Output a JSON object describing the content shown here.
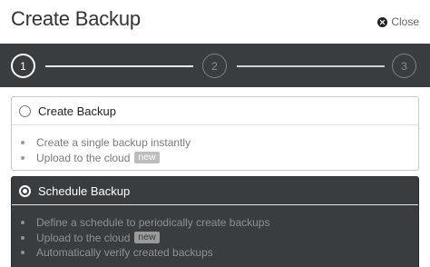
{
  "dialog": {
    "title": "Create Backup",
    "close_label": "Close"
  },
  "stepper": {
    "steps": [
      {
        "number": "1",
        "state": "active"
      },
      {
        "number": "2",
        "state": "inactive"
      },
      {
        "number": "3",
        "state": "inactive"
      }
    ]
  },
  "options": [
    {
      "label": "Create Backup",
      "selected": false,
      "features": [
        {
          "text": "Create a single backup instantly",
          "badge": ""
        },
        {
          "text": "Upload to the cloud",
          "badge": "new"
        }
      ]
    },
    {
      "label": "Schedule Backup",
      "selected": true,
      "features": [
        {
          "text": "Define a schedule to periodically create backups",
          "badge": ""
        },
        {
          "text": "Upload to the cloud",
          "badge": "new"
        },
        {
          "text": "Automatically verify created backups",
          "badge": ""
        }
      ]
    }
  ],
  "colors": {
    "dark_panel": "#3a3d3f",
    "text_dark": "#333333",
    "muted": "#7a7a7a"
  }
}
